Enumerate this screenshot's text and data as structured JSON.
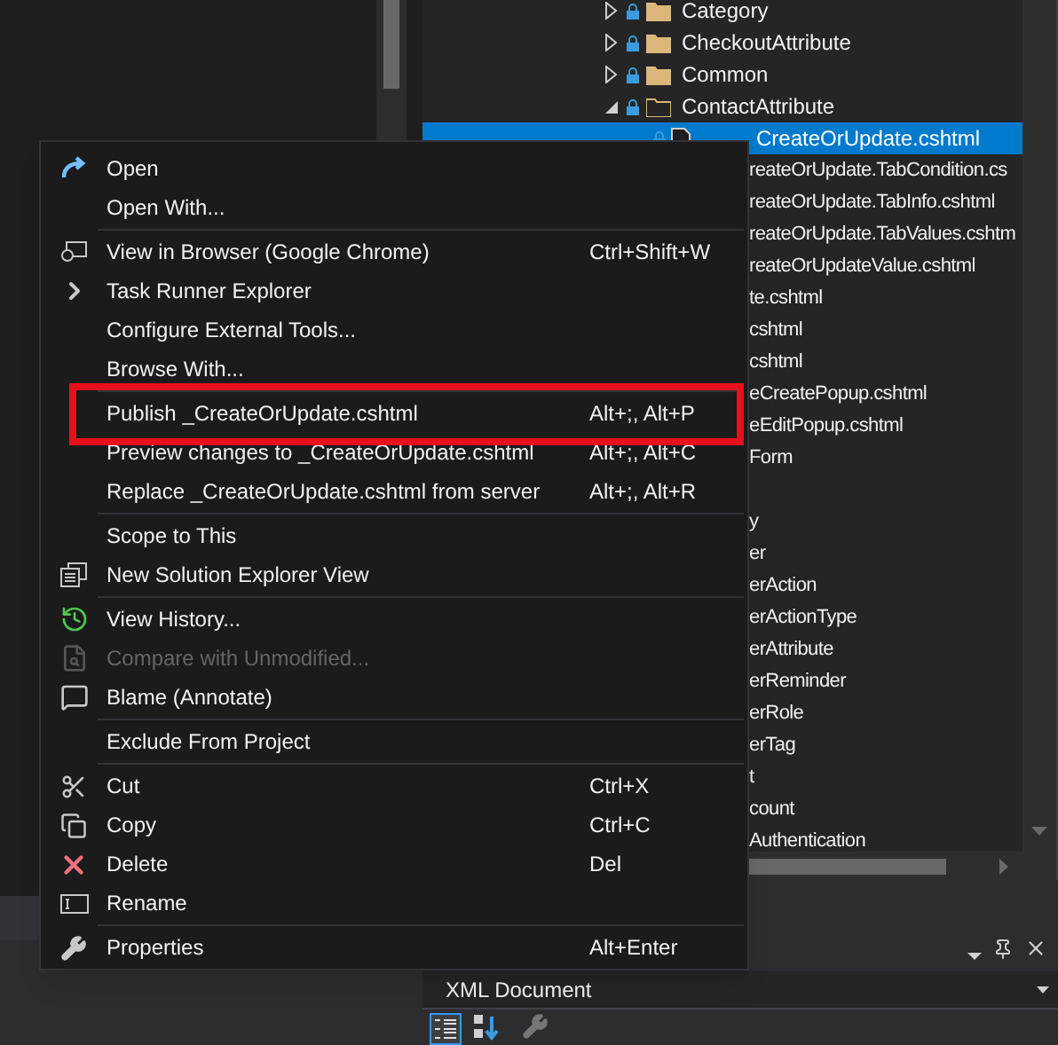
{
  "solution_tree": {
    "items": [
      {
        "kind": "folder",
        "label": "Category",
        "expanded": false,
        "selected": false
      },
      {
        "kind": "folder",
        "label": "CheckoutAttribute",
        "expanded": false,
        "selected": false
      },
      {
        "kind": "folder",
        "label": "Common",
        "expanded": false,
        "selected": false
      },
      {
        "kind": "folder",
        "label": "ContactAttribute",
        "expanded": true,
        "selected": false
      },
      {
        "kind": "file",
        "label": "CreateOrUpdate.cshtml",
        "selected": true
      },
      {
        "kind": "clipped",
        "label": "reateOrUpdate.TabCondition.cs",
        "selected": false
      },
      {
        "kind": "clipped",
        "label": "reateOrUpdate.TabInfo.cshtml",
        "selected": false
      },
      {
        "kind": "clipped",
        "label": "reateOrUpdate.TabValues.cshtm",
        "selected": false
      },
      {
        "kind": "clipped",
        "label": "reateOrUpdateValue.cshtml",
        "selected": false
      },
      {
        "kind": "clipped",
        "label": "te.cshtml",
        "selected": false
      },
      {
        "kind": "clipped",
        "label": "cshtml",
        "selected": false
      },
      {
        "kind": "clipped",
        "label": "cshtml",
        "selected": false
      },
      {
        "kind": "clipped",
        "label": "eCreatePopup.cshtml",
        "selected": false
      },
      {
        "kind": "clipped",
        "label": "eEditPopup.cshtml",
        "selected": false
      },
      {
        "kind": "clipped",
        "label": "Form",
        "selected": false
      },
      {
        "kind": "hidden",
        "selected": false
      },
      {
        "kind": "clipped",
        "label": "y",
        "selected": false
      },
      {
        "kind": "clipped",
        "label": "er",
        "selected": false
      },
      {
        "kind": "clipped",
        "label": "erAction",
        "selected": false
      },
      {
        "kind": "clipped",
        "label": "erActionType",
        "selected": false
      },
      {
        "kind": "clipped",
        "label": "erAttribute",
        "selected": false
      },
      {
        "kind": "clipped",
        "label": "erReminder",
        "selected": false
      },
      {
        "kind": "clipped",
        "label": "erRole",
        "selected": false
      },
      {
        "kind": "clipped",
        "label": "erTag",
        "selected": false
      },
      {
        "kind": "clipped",
        "label": "t",
        "selected": false
      },
      {
        "kind": "clipped",
        "label": "count",
        "selected": false
      },
      {
        "kind": "clipped",
        "label": "Authentication",
        "selected": false
      }
    ]
  },
  "context_menu": {
    "groups": [
      [
        {
          "label": "Open",
          "disabled": false,
          "highlighted": false
        },
        {
          "label": "Open With...",
          "disabled": false,
          "highlighted": false
        }
      ],
      [
        {
          "label": "View in Browser (Google Chrome)",
          "shortcut": "Ctrl+Shift+W",
          "disabled": false,
          "highlighted": false
        },
        {
          "label": "Task Runner Explorer",
          "disabled": false,
          "highlighted": false
        },
        {
          "label": "Configure External Tools...",
          "disabled": false,
          "highlighted": false
        },
        {
          "label": "Browse With...",
          "disabled": false,
          "highlighted": false
        }
      ],
      [
        {
          "label": "Publish _CreateOrUpdate.cshtml",
          "shortcut": "Alt+;, Alt+P",
          "disabled": false,
          "highlighted": true
        },
        {
          "label": "Preview changes to _CreateOrUpdate.cshtml",
          "shortcut": "Alt+;, Alt+C",
          "disabled": false,
          "highlighted": false
        },
        {
          "label": "Replace _CreateOrUpdate.cshtml from server",
          "shortcut": "Alt+;, Alt+R",
          "disabled": false,
          "highlighted": false
        }
      ],
      [
        {
          "label": "Scope to This",
          "disabled": false,
          "highlighted": false
        },
        {
          "label": "New Solution Explorer View",
          "disabled": false,
          "highlighted": false
        }
      ],
      [
        {
          "label": "View History...",
          "disabled": false,
          "highlighted": false
        },
        {
          "label": "Compare with Unmodified...",
          "disabled": true,
          "highlighted": false
        },
        {
          "label": "Blame (Annotate)",
          "disabled": false,
          "highlighted": false
        }
      ],
      [
        {
          "label": "Exclude From Project",
          "disabled": false,
          "highlighted": false
        }
      ],
      [
        {
          "label": "Cut",
          "shortcut": "Ctrl+X",
          "disabled": false,
          "highlighted": false
        },
        {
          "label": "Copy",
          "shortcut": "Ctrl+C",
          "disabled": false,
          "highlighted": false
        },
        {
          "label": "Delete",
          "shortcut": "Del",
          "disabled": false,
          "highlighted": false
        },
        {
          "label": "Rename",
          "disabled": false,
          "highlighted": false
        }
      ],
      [
        {
          "label": "Properties",
          "shortcut": "Alt+Enter",
          "disabled": false,
          "highlighted": false
        }
      ]
    ]
  },
  "properties_panel": {
    "object_selector": "XML Document"
  }
}
